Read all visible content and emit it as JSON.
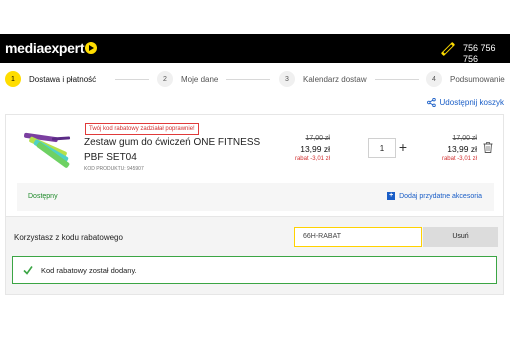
{
  "header": {
    "logo_text": "mediaexpert",
    "phone": "756 756 756",
    "background": "#000000",
    "accent": "#ffdd00"
  },
  "steps": [
    {
      "num": "1",
      "label": "Dostawa i płatność",
      "active": true
    },
    {
      "num": "2",
      "label": "Moje dane",
      "active": false
    },
    {
      "num": "3",
      "label": "Kalendarz dostaw",
      "active": false
    },
    {
      "num": "4",
      "label": "Podsumowanie",
      "active": false
    }
  ],
  "share_label": "Udostępnij koszyk",
  "product": {
    "promo_badge": "Twój kod rabatowy zadziałał poprawnie!",
    "name": "Zestaw gum do ćwiczeń ONE FITNESS PBF SET04",
    "code": "KOD PRODUKTU: 945907",
    "unit_price_old": "17,00 zł",
    "unit_price_new": "13,99 zł",
    "unit_discount": "rabat -3,01 zł",
    "quantity": "1",
    "total_price_old": "17,00 zł",
    "total_price_new": "13,99 zł",
    "total_discount": "rabat -3,01 zł",
    "availability": "Dostępny",
    "add_accessories": "Dodaj przydatne akcesoria",
    "band_colors": [
      "#7b3fa0",
      "#b6e04a",
      "#4fd1c5",
      "#6ed163"
    ]
  },
  "discount": {
    "label": "Korzystasz z kodu rabatowego",
    "code_value": "66H-RABAT",
    "remove_label": "Usuń",
    "success_message": "Kod rabatowy został dodany.",
    "success_color": "#3ba544"
  },
  "colors": {
    "link": "#1a5ec7",
    "discount_red": "#d23030",
    "available_green": "#1f8a2a"
  }
}
